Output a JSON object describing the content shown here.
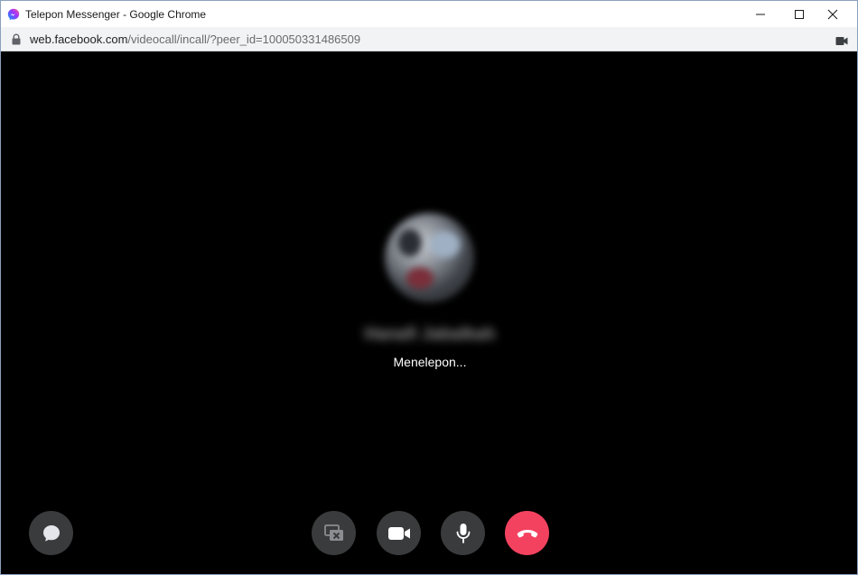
{
  "window": {
    "title": "Telepon Messenger - Google Chrome"
  },
  "addressbar": {
    "url_host": "web.facebook.com",
    "url_path": "/videocall/incall/?peer_id=100050331486509"
  },
  "call": {
    "caller_name": "Hanafi Jabalkah",
    "status": "Menelepon..."
  },
  "icons": {
    "app": "messenger-icon",
    "lock": "lock-icon",
    "camera": "camera-icon",
    "chat": "chat-bubble-icon",
    "screen_share": "screen-share-off-icon",
    "video": "video-camera-icon",
    "mic": "microphone-icon",
    "end_call": "phone-hangup-icon"
  },
  "colors": {
    "stage_background": "#000000",
    "control_background": "#3a3b3c",
    "end_call": "#f3425f",
    "messenger_gradient_start": "#0099ff",
    "messenger_gradient_end": "#a033ff"
  }
}
